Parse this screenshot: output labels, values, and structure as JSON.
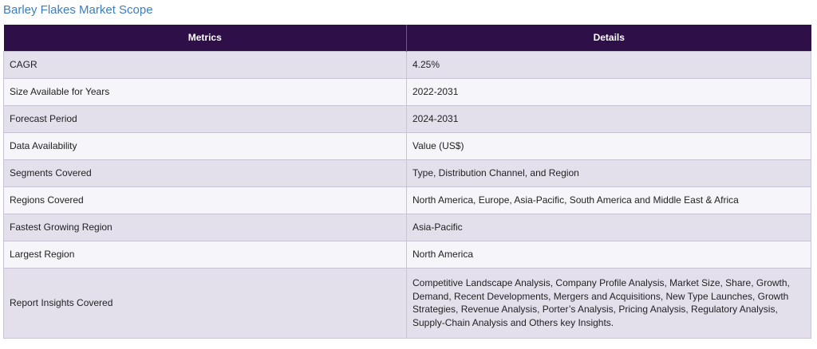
{
  "title": "Barley Flakes Market Scope",
  "table": {
    "headers": [
      "Metrics",
      "Details"
    ],
    "rows": [
      {
        "metric": "CAGR",
        "detail": "4.25%"
      },
      {
        "metric": "Size Available for Years",
        "detail": "2022-2031"
      },
      {
        "metric": "Forecast Period",
        "detail": "2024-2031"
      },
      {
        "metric": "Data Availability",
        "detail": "Value (US$)"
      },
      {
        "metric": "Segments Covered",
        "detail": "Type, Distribution Channel, and Region"
      },
      {
        "metric": "Regions Covered",
        "detail": "North America, Europe, Asia-Pacific, South America and Middle East & Africa"
      },
      {
        "metric": "Fastest Growing Region",
        "detail": "Asia-Pacific"
      },
      {
        "metric": "Largest Region",
        "detail": "North America"
      },
      {
        "metric": "Report Insights Covered",
        "detail": "Competitive Landscape Analysis, Company Profile Analysis, Market Size, Share, Growth, Demand, Recent Developments, Mergers and Acquisitions, New Type Launches, Growth Strategies, Revenue Analysis, Porter’s Analysis, Pricing Analysis, Regulatory Analysis, Supply-Chain Analysis and Others key Insights."
      }
    ]
  }
}
